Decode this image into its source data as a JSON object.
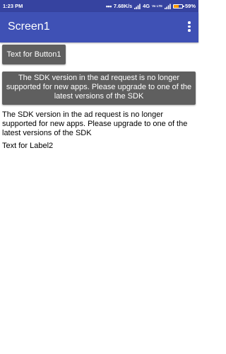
{
  "status_bar": {
    "time": "1:23 PM",
    "speed": "7.68K/s",
    "network": "4G",
    "volte": "Vo LTE",
    "battery": "59%",
    "battery_level": 0.59
  },
  "app_bar": {
    "title": "Screen1",
    "menu_icon": "overflow-menu-icon"
  },
  "button1": {
    "label": "Text for Button1"
  },
  "sdk_notice": {
    "text": "The SDK version in the ad request is no longer supported for new apps. Please upgrade to one of the latest versions of the SDK"
  },
  "label1": {
    "text": "The SDK version in the ad request is no longer supported for new apps. Please upgrade to one of the latest versions of the SDK"
  },
  "label2": {
    "text": "Text for Label2"
  },
  "colors": {
    "status_bar": "#3643a0",
    "app_bar": "#3f51b5",
    "button": "#5f5f5f",
    "battery": "#ff9800"
  }
}
